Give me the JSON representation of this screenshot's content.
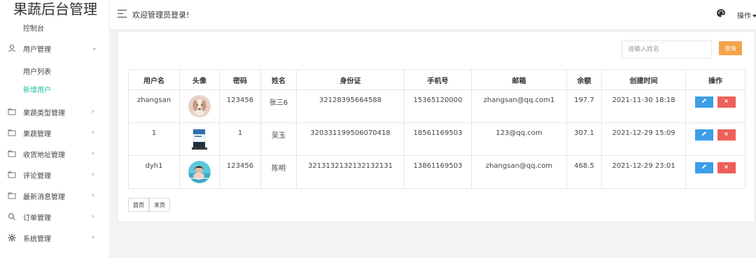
{
  "app": {
    "title": "果蔬后台管理"
  },
  "sidebar": {
    "items": [
      {
        "label": "控制台",
        "icon": "none",
        "arrow": ""
      },
      {
        "label": "用户管理",
        "icon": "user-icon",
        "arrow": "⌄"
      },
      {
        "label": "用户列表",
        "icon": "none",
        "arrow": ""
      },
      {
        "label": "新增用户",
        "icon": "none",
        "arrow": "",
        "active": true
      },
      {
        "label": "果蔬类型管理",
        "icon": "folder-icon",
        "arrow": "›"
      },
      {
        "label": "果蔬管理",
        "icon": "folder-icon",
        "arrow": "›"
      },
      {
        "label": "收货地址管理",
        "icon": "folder-icon",
        "arrow": "›"
      },
      {
        "label": "评论管理",
        "icon": "folder-icon",
        "arrow": "›"
      },
      {
        "label": "最新消息管理",
        "icon": "folder-icon",
        "arrow": "›"
      },
      {
        "label": "订单管理",
        "icon": "search-icon",
        "arrow": "›"
      },
      {
        "label": "系统管理",
        "icon": "gear-icon",
        "arrow": "›"
      }
    ]
  },
  "header": {
    "welcome": "欢迎管理员登录!",
    "ops_label": "操作"
  },
  "search": {
    "placeholder": "请输入姓名",
    "value": "",
    "button": "查询"
  },
  "table": {
    "columns": [
      "用户名",
      "头像",
      "密码",
      "姓名",
      "身份证",
      "手机号",
      "邮箱",
      "余额",
      "创建时间",
      "操作"
    ],
    "rows": [
      {
        "username": "zhangsan",
        "avatar": "dog-avatar",
        "password": "123456",
        "name": "张三6",
        "id_card": "32128395664588",
        "phone": "15365120000",
        "email": "zhangsan@qq.com1",
        "balance": "197.7",
        "created": "2021-11-30 18:18"
      },
      {
        "username": "1",
        "avatar": "book-avatar",
        "password": "1",
        "name": "吴玉",
        "id_card": "320331199506070418",
        "phone": "18561169503",
        "email": "123@qq.com",
        "balance": "307.1",
        "created": "2021-12-29 15:09"
      },
      {
        "username": "dyh1",
        "avatar": "pool-avatar",
        "password": "123456",
        "name": "陈明",
        "id_card": "3213132132132132131",
        "phone": "13861169503",
        "email": "zhangsan@qq.com",
        "balance": "468.5",
        "created": "2021-12-29 23:01"
      }
    ],
    "edit_icon": "pencil-icon",
    "delete_icon": "close-icon"
  },
  "pager": {
    "first": "首页",
    "last": "末页"
  },
  "colors": {
    "accent": "#1abc9c",
    "search_button": "#f6a34a",
    "edit_button": "#3d9ee8",
    "delete_button": "#ee5f5b"
  }
}
